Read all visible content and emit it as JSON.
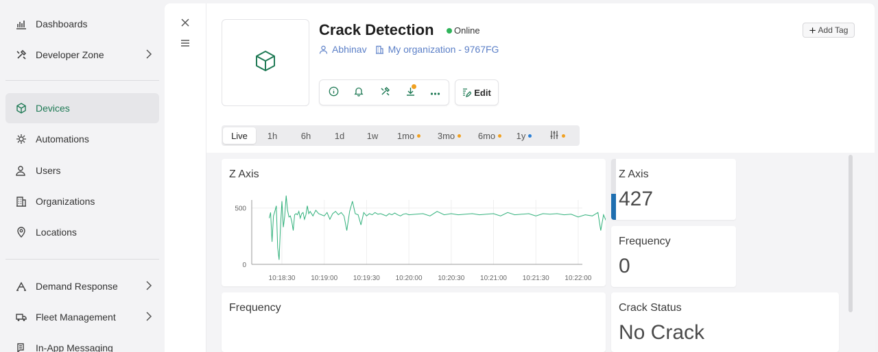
{
  "sidebar": {
    "items": [
      {
        "label": "Dashboards",
        "icon": "chart-bar-icon"
      },
      {
        "label": "Developer Zone",
        "icon": "tools-icon"
      },
      {
        "label": "Devices",
        "icon": "cube-icon"
      },
      {
        "label": "Automations",
        "icon": "automation-icon"
      },
      {
        "label": "Users",
        "icon": "users-icon"
      },
      {
        "label": "Organizations",
        "icon": "building-icon"
      },
      {
        "label": "Locations",
        "icon": "location-pin-icon"
      },
      {
        "label": "Demand Response",
        "icon": "demand-response-icon"
      },
      {
        "label": "Fleet Management",
        "icon": "truck-icon"
      },
      {
        "label": "In-App Messaging",
        "icon": "messaging-icon"
      }
    ],
    "active": "Devices"
  },
  "device": {
    "name": "Crack Detection",
    "status": "Online",
    "owner": "Abhinav",
    "organization": "My organization - 9767FG"
  },
  "header": {
    "add_tag_label": "Add Tag",
    "edit_label": "Edit"
  },
  "time_range": {
    "options": [
      {
        "label": "Live",
        "active": true,
        "dot": null
      },
      {
        "label": "1h",
        "dot": null
      },
      {
        "label": "6h",
        "dot": null
      },
      {
        "label": "1d",
        "dot": null
      },
      {
        "label": "1w",
        "dot": null
      },
      {
        "label": "1mo",
        "dot": "#f0a020"
      },
      {
        "label": "3mo",
        "dot": "#f0a020"
      },
      {
        "label": "6mo",
        "dot": "#f0a020"
      },
      {
        "label": "1y",
        "dot": "#2a7fd6"
      }
    ],
    "custom_dot": "#f0a020"
  },
  "widgets": {
    "z_axis_chart": {
      "title": "Z Axis"
    },
    "frequency_chart": {
      "title": "Frequency"
    },
    "z_axis_value": {
      "title": "Z Axis",
      "value": "427",
      "level_fraction": 0.43,
      "accent": "#1f6fb0"
    },
    "frequency_value": {
      "title": "Frequency",
      "value": "0"
    },
    "crack_status": {
      "title": "Crack Status",
      "value": "No Crack"
    }
  },
  "chart_data": {
    "type": "line",
    "title": "Z Axis",
    "x_ticks": [
      "10:18:30",
      "10:19:00",
      "10:19:30",
      "10:20:00",
      "10:20:30",
      "10:21:00",
      "10:21:30",
      "10:22:00"
    ],
    "y_ticks": [
      "0",
      "500"
    ],
    "ylim": [
      0,
      620
    ],
    "color": "#2fb07a",
    "series": [
      {
        "x_seconds_from_1018": [
          21,
          22,
          23,
          24,
          25,
          26,
          27,
          28,
          29,
          30,
          31,
          32,
          33,
          34,
          35,
          36,
          37,
          38,
          39,
          40,
          41,
          42,
          43,
          44,
          45,
          46,
          47,
          48,
          49,
          50,
          52,
          54,
          56,
          58,
          60,
          62,
          64,
          66,
          68,
          70,
          72,
          74,
          76,
          78,
          80,
          82,
          84,
          86,
          88,
          90,
          92,
          94,
          96,
          98,
          100,
          102,
          104,
          106,
          108,
          110,
          112,
          114,
          116,
          118,
          120,
          125,
          130,
          135,
          140,
          145,
          150,
          155,
          160,
          165,
          170,
          175,
          180,
          185,
          190,
          195,
          200,
          205,
          210,
          215,
          220,
          225,
          230,
          235,
          240,
          245,
          250,
          254,
          256,
          258,
          260,
          262,
          264,
          266,
          268,
          270,
          272,
          274,
          276,
          278,
          280,
          282,
          284,
          286,
          288,
          290,
          292,
          294,
          296,
          298,
          300,
          302,
          304
        ],
        "values": [
          410,
          460,
          200,
          430,
          470,
          520,
          150,
          40,
          340,
          560,
          330,
          430,
          610,
          480,
          420,
          430,
          380,
          300,
          440,
          450,
          440,
          470,
          410,
          450,
          460,
          400,
          440,
          520,
          450,
          470,
          430,
          480,
          450,
          440,
          430,
          460,
          400,
          450,
          470,
          440,
          460,
          430,
          300,
          470,
          560,
          450,
          440,
          350,
          460,
          430,
          450,
          440,
          460,
          445,
          450,
          440,
          430,
          450,
          440,
          455,
          440,
          430,
          445,
          450,
          440,
          445,
          450,
          430,
          470,
          440,
          450,
          440,
          445,
          450,
          440,
          445,
          450,
          430,
          460,
          440,
          445,
          450,
          430,
          450,
          445,
          450,
          440,
          445,
          420,
          440,
          430,
          460,
          300,
          440,
          380,
          200,
          440,
          570,
          460,
          600,
          450,
          430,
          410,
          460,
          350,
          440,
          470,
          420,
          450,
          300,
          440,
          460,
          430,
          445,
          440,
          445,
          440
        ]
      }
    ],
    "note_x_display": "time"
  }
}
